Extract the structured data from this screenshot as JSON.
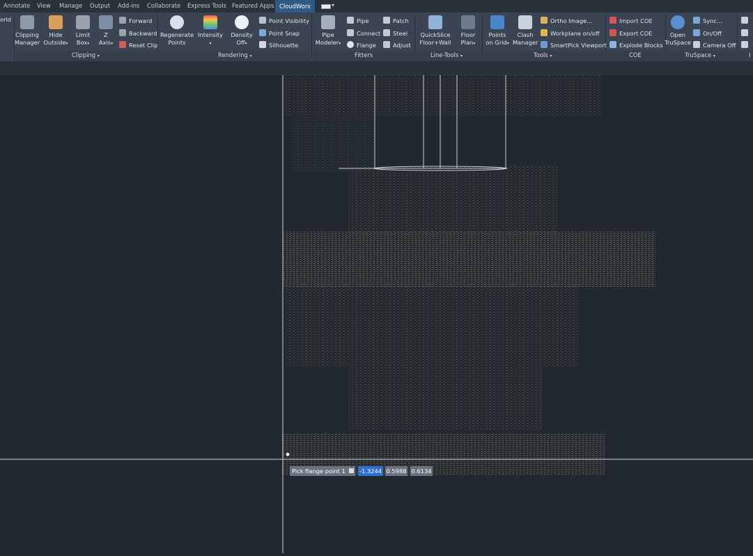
{
  "tabs": [
    "Annotate",
    "View",
    "Manage",
    "Output",
    "Add-ins",
    "Collaborate",
    "Express Tools",
    "Featured Apps",
    "CloudWorx"
  ],
  "ribbon": {
    "world_label": "orld",
    "clipping": {
      "title": "Clipping",
      "manager": "Clipping Manager",
      "hide_outside": "Hide Outside",
      "limit_box": "Limit Box",
      "z_axis": "Z Axis",
      "forward": "Forward",
      "backward": "Backward",
      "reset_clip": "Reset Clip"
    },
    "rendering": {
      "title": "Rendering",
      "regenerate": "Regenerate Points",
      "intensity": "Intensity",
      "density": "Density Off",
      "point_visibility": "Point Visibility",
      "point_snap": "Point Snap",
      "silhouette": "Silhouette"
    },
    "fitters": {
      "title": "Fitters",
      "pipe_modeler": "Pipe Modeler",
      "pipe": "Pipe",
      "connect": "Connect",
      "flange": "Flange",
      "patch": "Patch",
      "steel": "Steel",
      "adjust": "Adjust"
    },
    "line_tools": {
      "title": "Line-Tools",
      "quickslice": "QuickSlice Floor+Wall",
      "floor_plan": "Floor Plan"
    },
    "tools": {
      "title": "Tools",
      "points_on_grid": "Points on Grid",
      "clash_manager": "Clash Manager",
      "ortho_image": "Ortho Image...",
      "workplane": "Workplane on/off",
      "smartpick": "SmartPick Viewport"
    },
    "coe": {
      "title": "COE",
      "import": "Import COE",
      "export": "Export COE",
      "explode": "Explode Blocks"
    },
    "truspace": {
      "title": "TruSpace",
      "open": "Open TruSpace",
      "sync": "Sync...",
      "onoff": "On/Off",
      "camera_off": "Camera Off"
    },
    "cut_title": "I"
  },
  "command": {
    "prompt": "Pick flange point 1",
    "x": "-1.3244",
    "y": "0.5988",
    "z": "0.6134"
  },
  "colors": {
    "accent": "#2e5a86",
    "viewport": "#212830",
    "ribbon": "#3b4453"
  }
}
